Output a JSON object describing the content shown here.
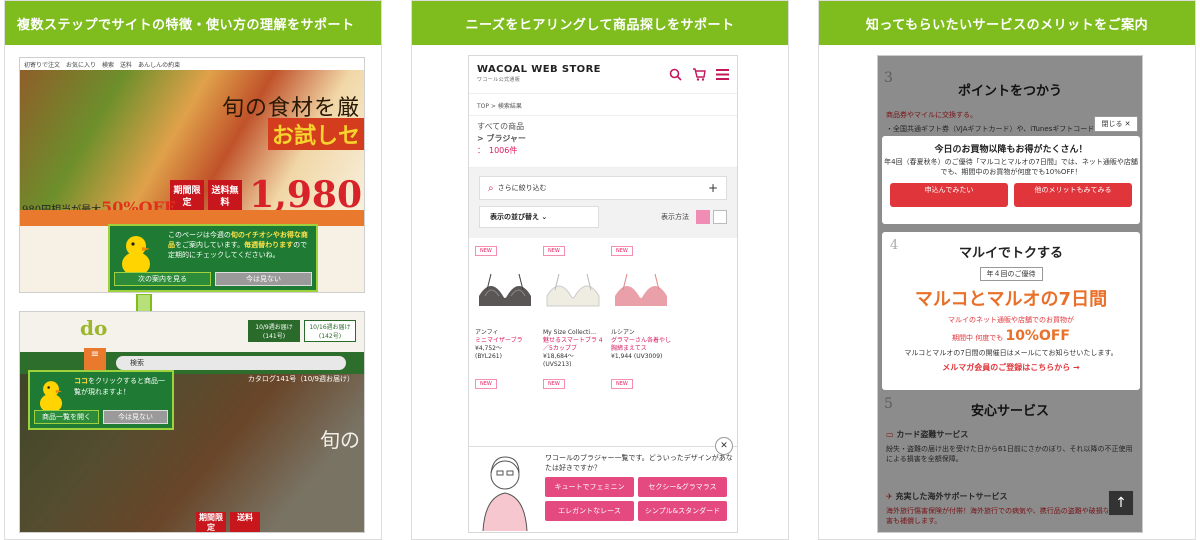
{
  "panels": [
    {
      "header": "複数ステップでサイトの特徴・使い方の理解をサポート"
    },
    {
      "header": "ニーズをヒアリングして商品探しをサポート"
    },
    {
      "header": "知ってもらいたいサービスのメリットをご案内"
    }
  ],
  "p1": {
    "toplinks": [
      "初寄りで注文",
      "お気に入り",
      "検索",
      "送料",
      "あんしんの約束"
    ],
    "hero_title": "旬の食材を厳",
    "hero_sub": "お試しセ",
    "price": "1,980",
    "off_prefix": "980円相当が最大",
    "off_value": "50%OFF",
    "tag1": "期間限定",
    "tag2": "送料無料",
    "tip_text1": "このページは今週の",
    "tip_hl1": "旬のイチオシやお得な商品",
    "tip_text2": "をご案内しています。",
    "tip_hl2": "毎週替わります",
    "tip_text3": "ので定期的にチェックしてくださいね。",
    "btn_next": "次の案内を見る",
    "btn_skip": "今は見ない",
    "logo": "do",
    "tab1": "10/9週お届け\n(141号)",
    "tab2": "10/16週お届け\n(142号)",
    "menu": "≡",
    "search_ph": "検索",
    "catalog": "カタログ141号（10/9週お届け）",
    "b_serif": "旬の",
    "tip2_hl": "ココ",
    "tip2_text": "をクリックすると商品一覧が現れますよ！",
    "btn_list": "商品一覧を開く",
    "btn_skip2": "今は見ない",
    "b_tag1": "期間限定",
    "b_tag2": "送料"
  },
  "p2": {
    "logo": "WACOAL WEB STORE",
    "logo_sub": "ワコール公式通販",
    "crumb": "TOP > 検索結果",
    "cat1": "すべての商品",
    "cat2": "> ブラジャー",
    "count": "：　1006件",
    "refine": "さらに絞り込む",
    "sort": "表示の並び替え",
    "view": "表示方法",
    "new_label": "NEW",
    "products": [
      {
        "brand": "アンフィ",
        "name": "ミニマイザーブラ",
        "price": "¥4,752〜",
        "code": "(BYL261)"
      },
      {
        "brand": "My Size Collecti…",
        "name": "魅せるスマートブラ 4／5カップブ",
        "price": "¥18,684〜",
        "code": "(UVS213)"
      },
      {
        "brand": "ルシアン",
        "name": "グラマーさん各着やし 胸締まえてス",
        "price": "¥1,944 (UV3009)",
        "code": ""
      }
    ],
    "question": "ワコールのブラジャー一覧です。どういったデザインがあなたは好きですか？",
    "opts": [
      "キュートでフェミニン",
      "セクシー&グラマラス",
      "エレガントなレース",
      "シンプル&スタンダード"
    ]
  },
  "p3": {
    "n3": "3",
    "sec3": "ポイントをつかう",
    "line3a": "商品券やマイルに交換する。",
    "line3b": "・全国共通ギフト券（VJAギフトカード）や、iTunesギフトコード…",
    "close": "閉じる ✕",
    "pop_title": "今日のお買物以降もお得がたくさん！",
    "pop_text": "年4回（春夏秋冬）のご優待「マルコとマルオの7日間」では、ネット通販や店舗でも、期間中のお買物が何度でも10%OFF！",
    "pop_btn1": "申込んでみたい",
    "pop_btn2": "他のメリットもみてみる",
    "n4": "4",
    "card_title": "マルイでトクする",
    "badge": "年４回のご優待",
    "big": "マルコとマルオの7日間",
    "l1": "マルイのネット通販や店舗でのお買物が",
    "l2a": "期間中 何度でも",
    "l2b": "10%OFF",
    "l3": "マルコとマルオの7日間の開催日はメールにてお知らせいたします。",
    "l4": "メルマガ会員のご登録はこちらから →",
    "n5": "5",
    "sec5": "安心サービス",
    "line5a": "カード盗難サービス",
    "line5b": "紛失・盗難の届け出を受けた日から61日前にさかのぼり、それ以降の不正使用による損害を全額保障。",
    "line5c": "充実した海外サポートサービス",
    "line5d": "海外旅行傷害保険が付帯！海外旅行での病気や、携行品の盗難や破損などの損害も補償します。",
    "totop": "↑"
  }
}
